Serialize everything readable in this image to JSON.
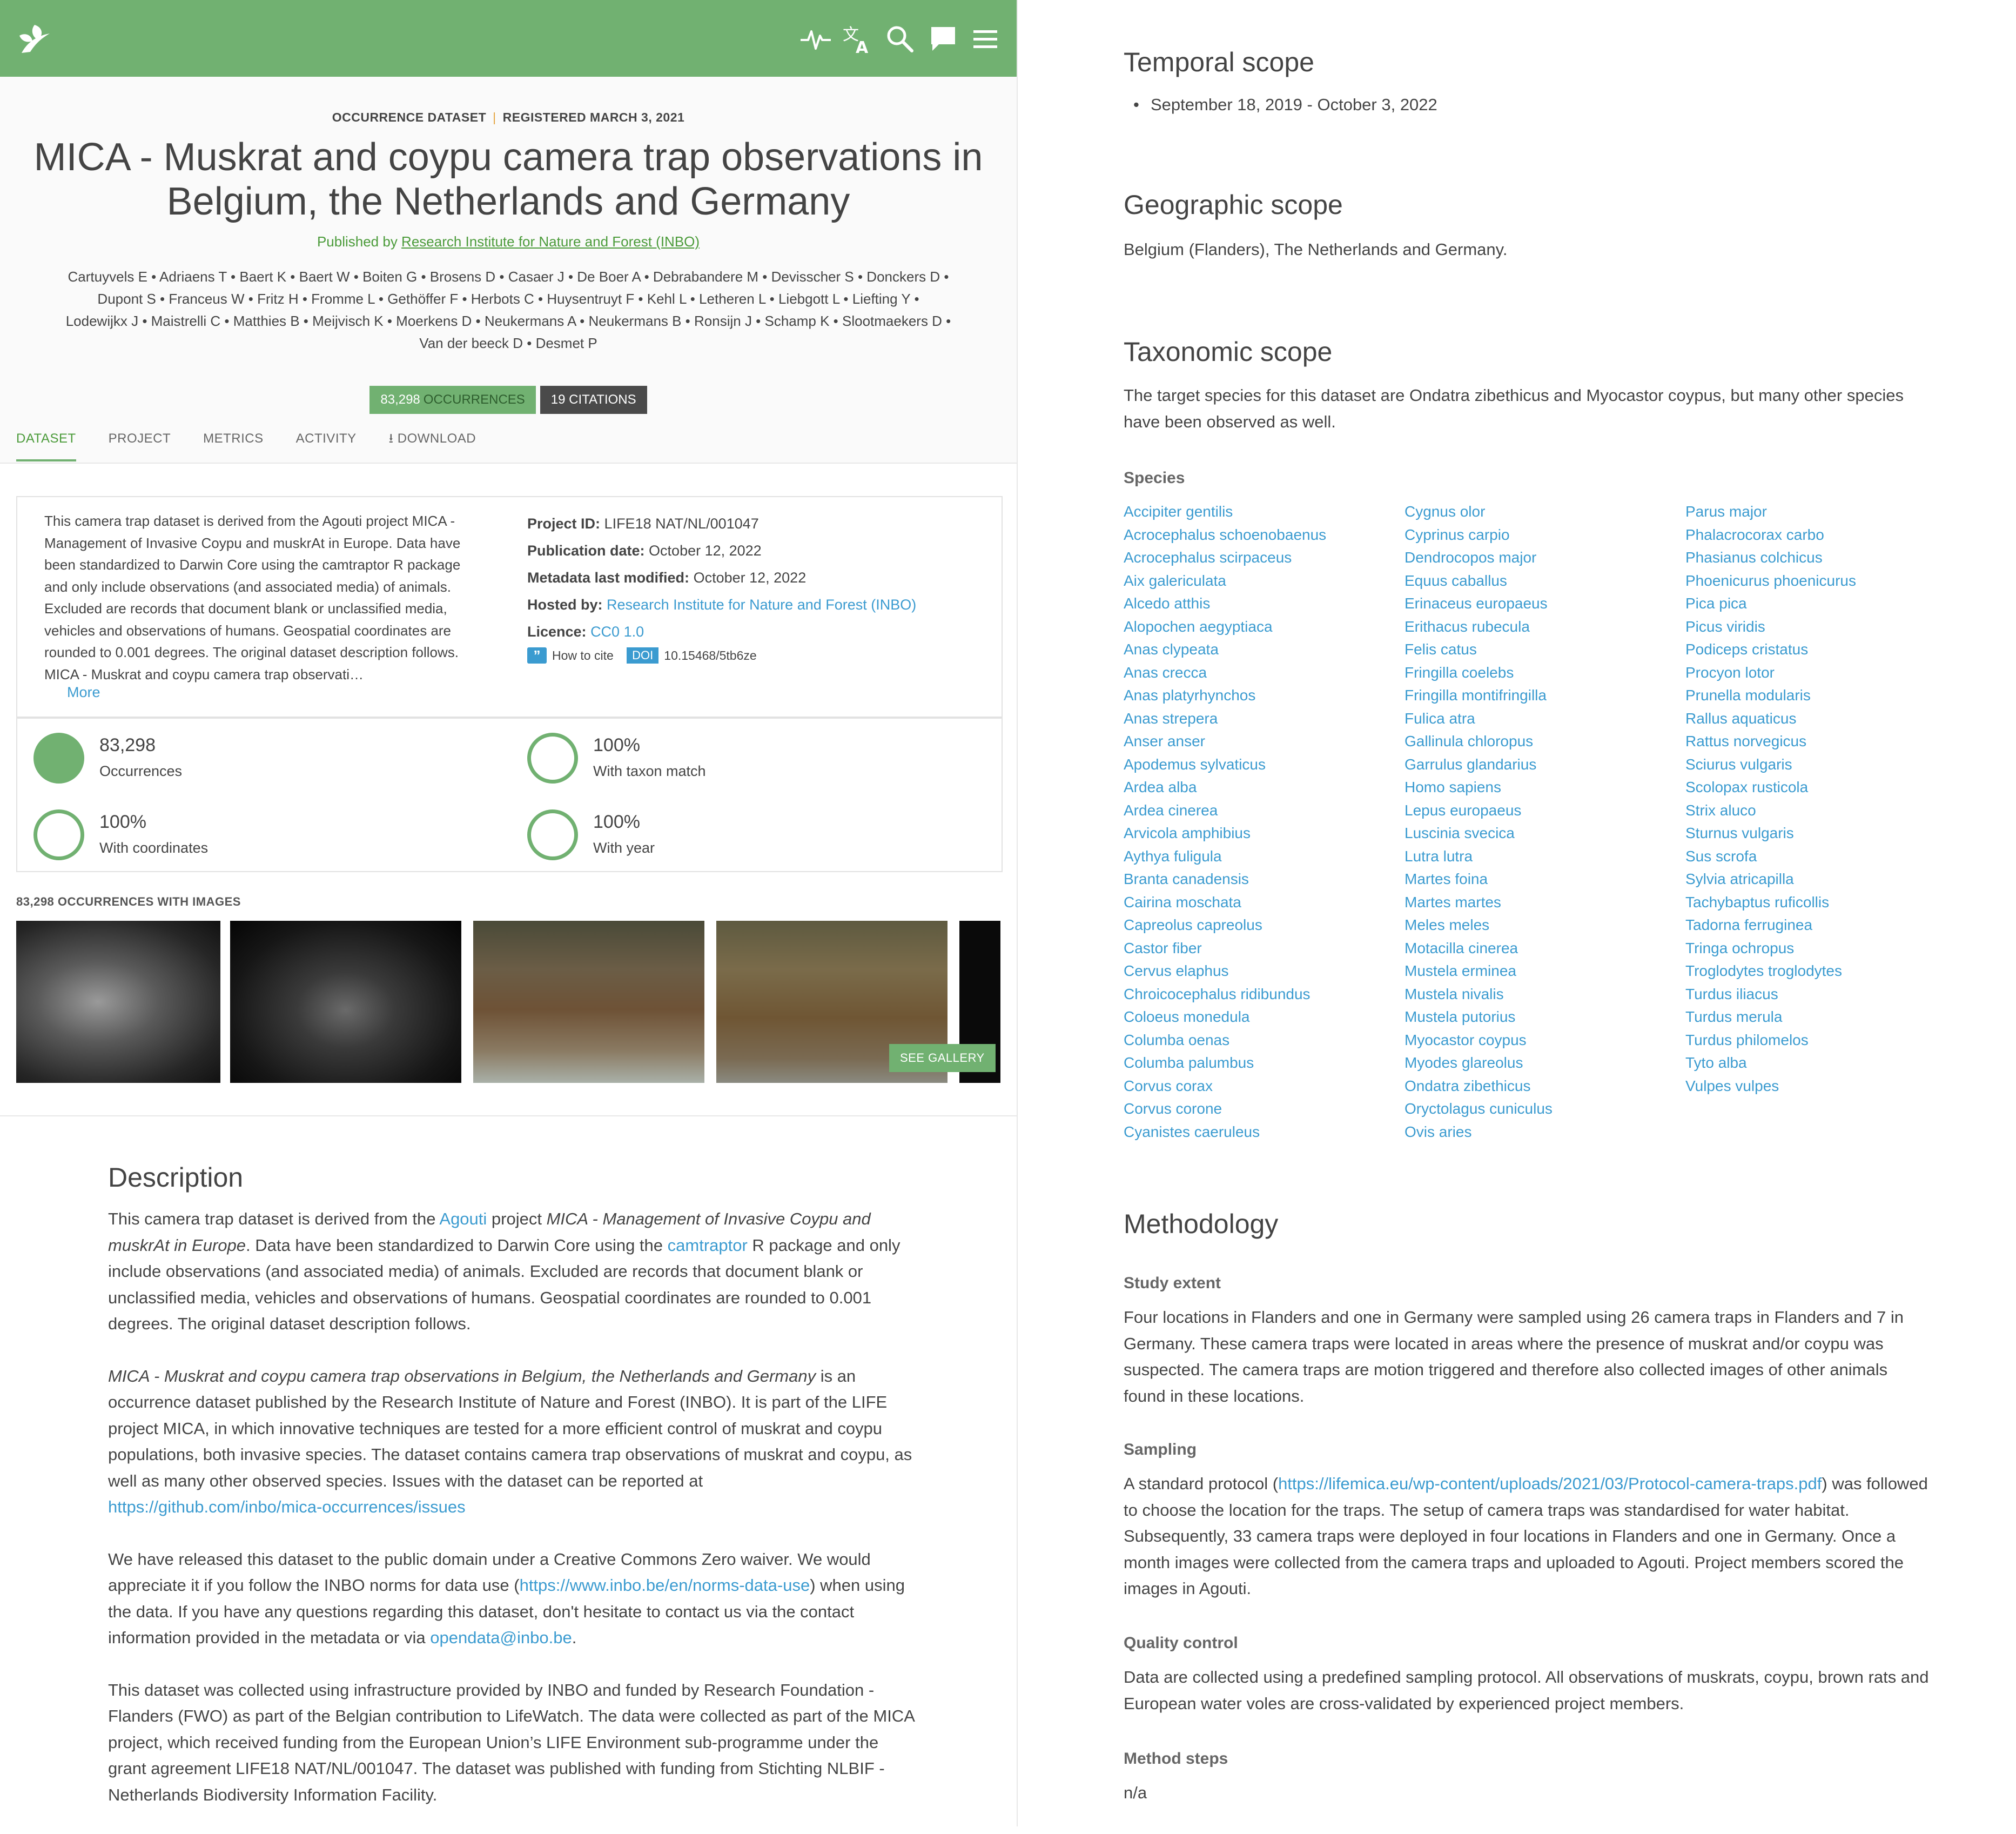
{
  "colors": {
    "brand_green": "#71b171",
    "link_blue": "#3b9bd0",
    "dark_badge": "#4a4a4a",
    "text": "#444444"
  },
  "topbar": {
    "logo_icon": "leaf-logo-icon",
    "icons": [
      "activity-icon",
      "translate-icon",
      "search-icon",
      "feedback-icon",
      "menu-icon"
    ]
  },
  "dataset": {
    "type": "OCCURRENCE DATASET",
    "separator": "|",
    "registered": "REGISTERED MARCH 3, 2021",
    "title": "MICA - Muskrat and coypu camera trap observations in Belgium, the Netherlands and Germany",
    "published_prefix": "Published by ",
    "publisher": "Research Institute for Nature and Forest (INBO)",
    "authors": [
      "Cartuyvels E • Adriaens T • Baert K • Baert W • Boiten G • Brosens D • Casaer J • De Boer A • Debrabandere M • Devisscher S • Donckers D •",
      "Dupont S • Franceus W • Fritz H • Fromme L • Gethöffer F • Herbots C • Huysentruyt F • Kehl L • Letheren L • Liebgott L • Liefting Y •",
      "Lodewijkx J • Maistrelli C • Matthies B • Meijvisch K • Moerkens D • Neukermans A • Neukermans B • Ronsijn J • Schamp K • Slootmaekers D •",
      "Van der beeck D • Desmet P"
    ],
    "occurrences_count": "83,298",
    "occurrences_label": "OCCURRENCES",
    "citations": "19 CITATIONS"
  },
  "tabs": [
    "DATASET",
    "PROJECT",
    "METRICS",
    "ACTIVITY",
    "DOWNLOAD"
  ],
  "summary": {
    "text": "This camera trap dataset is derived from the Agouti project MICA - Management of Invasive Coypu and muskrAt in Europe. Data have been standardized to Darwin Core using the camtraptor R package and only include observations (and associated media) of animals. Excluded are records that document blank or unclassified media, vehicles and observations of humans. Geospatial coordinates are rounded to 0.001 degrees. The original dataset description follows. MICA - Muskrat and coypu camera trap observati…",
    "more": "More",
    "project_id_label": "Project ID:",
    "project_id": "LIFE18 NAT/NL/001047",
    "pub_date_label": "Publication date:",
    "pub_date": "October 12, 2022",
    "modified_label": "Metadata last modified:",
    "modified": "October 12, 2022",
    "hosted_label": "Hosted by:",
    "hosted": "Research Institute for Nature and Forest (INBO)",
    "licence_label": "Licence:",
    "licence": "CC0 1.0",
    "cite_icon": "”",
    "how_to_cite": "How to cite",
    "doi_label": "DOI",
    "doi": "10.15468/5tb6ze"
  },
  "metrics": [
    {
      "value": "83,298",
      "label": "Occurrences",
      "fill": 1.0
    },
    {
      "value": "100%",
      "label": "With taxon match",
      "fill": 1.0
    },
    {
      "value": "100%",
      "label": "With coordinates",
      "fill": 1.0
    },
    {
      "value": "100%",
      "label": "With year",
      "fill": 1.0
    }
  ],
  "images": {
    "heading": "83,298 OCCURRENCES WITH IMAGES",
    "see_gallery": "SEE GALLERY"
  },
  "description": {
    "heading": "Description",
    "p1_a": "This camera trap dataset is derived from the ",
    "p1_link1": "Agouti",
    "p1_b": " project ",
    "p1_em": "MICA - Management of Invasive Coypu and muskrAt in Europe",
    "p1_c": ". Data have been standardized to Darwin Core using the ",
    "p1_link2": "camtraptor",
    "p1_d": " R package and only include observations (and associated media) of animals. Excluded are records that document blank or unclassified media, vehicles and observations of humans. Geospatial coordinates are rounded to 0.001 degrees. The original dataset description follows.",
    "p2_em": "MICA - Muskrat and coypu camera trap observations in Belgium, the Netherlands and Germany",
    "p2_a": " is an occurrence dataset published by the Research Institute of Nature and Forest (INBO). It is part of the LIFE project MICA, in which innovative techniques are tested for a more efficient control of muskrat and coypu populations, both invasive species. The dataset contains camera trap observations of muskrat and coypu, as well as many other observed species. Issues with the dataset can be reported at ",
    "p2_link": "https://github.com/inbo/mica-occurrences/issues",
    "p3_a": "We have released this dataset to the public domain under a Creative Commons Zero waiver. We would appreciate it if you follow the INBO norms for data use (",
    "p3_link1": "https://www.inbo.be/en/norms-data-use",
    "p3_b": ") when using the data. If you have any questions regarding this dataset, don't hesitate to contact us via the contact information provided in the metadata or via ",
    "p3_link2": "opendata@inbo.be",
    "p3_c": ".",
    "p4": "This dataset was collected using infrastructure provided by INBO and funded by Research Foundation - Flanders (FWO) as part of the Belgian contribution to LifeWatch. The data were collected as part of the MICA project, which received funding from the European Union’s LIFE Environment sub-programme under the grant agreement LIFE18 NAT/NL/001047. The dataset was published with funding from Stichting NLBIF - Netherlands Biodiversity Information Facility."
  },
  "temporal": {
    "heading": "Temporal scope",
    "range": "September 18, 2019 - October 3, 2022"
  },
  "geographic": {
    "heading": "Geographic scope",
    "text": "Belgium (Flanders), The Netherlands and Germany."
  },
  "taxonomic": {
    "heading": "Taxonomic scope",
    "text": "The target species for this dataset are Ondatra zibethicus and Myocastor coypus, but many other species have been observed as well.",
    "species_heading": "Species",
    "species_cols": [
      [
        "Accipiter gentilis",
        "Acrocephalus schoenobaenus",
        "Acrocephalus scirpaceus",
        "Aix galericulata",
        "Alcedo atthis",
        "Alopochen aegyptiaca",
        "Anas clypeata",
        "Anas crecca",
        "Anas platyrhynchos",
        "Anas strepera",
        "Anser anser",
        "Apodemus sylvaticus",
        "Ardea alba",
        "Ardea cinerea",
        "Arvicola amphibius",
        "Aythya fuligula",
        "Branta canadensis",
        "Cairina moschata",
        "Capreolus capreolus",
        "Castor fiber",
        "Cervus elaphus",
        "Chroicocephalus ridibundus",
        "Coloeus monedula",
        "Columba oenas",
        "Columba palumbus",
        "Corvus corax",
        "Corvus corone",
        "Cyanistes caeruleus"
      ],
      [
        "Cygnus olor",
        "Cyprinus carpio",
        "Dendrocopos major",
        "Equus caballus",
        "Erinaceus europaeus",
        "Erithacus rubecula",
        "Felis catus",
        "Fringilla coelebs",
        "Fringilla montifringilla",
        "Fulica atra",
        "Gallinula chloropus",
        "Garrulus glandarius",
        "Homo sapiens",
        "Lepus europaeus",
        "Luscinia svecica",
        "Lutra lutra",
        "Martes foina",
        "Martes martes",
        "Meles meles",
        "Motacilla cinerea",
        "Mustela erminea",
        "Mustela nivalis",
        "Mustela putorius",
        "Myocastor coypus",
        "Myodes glareolus",
        "Ondatra zibethicus",
        "Oryctolagus cuniculus",
        "Ovis aries"
      ],
      [
        "Parus major",
        "Phalacrocorax carbo",
        "Phasianus colchicus",
        "Phoenicurus phoenicurus",
        "Pica pica",
        "Picus viridis",
        "Podiceps cristatus",
        "Procyon lotor",
        "Prunella modularis",
        "Rallus aquaticus",
        "Rattus norvegicus",
        "Sciurus vulgaris",
        "Scolopax rusticola",
        "Strix aluco",
        "Sturnus vulgaris",
        "Sus scrofa",
        "Sylvia atricapilla",
        "Tachybaptus ruficollis",
        "Tadorna ferruginea",
        "Tringa ochropus",
        "Troglodytes troglodytes",
        "Turdus iliacus",
        "Turdus merula",
        "Turdus philomelos",
        "Tyto alba",
        "Vulpes vulpes"
      ]
    ]
  },
  "methodology": {
    "heading": "Methodology",
    "study_extent_h": "Study extent",
    "study_extent": "Four locations in Flanders and one in Germany were sampled using 26 camera traps in Flanders and 7 in Germany. These camera traps were located in areas where the presence of muskrat and/or coypu was suspected. The camera traps are motion triggered and therefore also collected images of other animals found in these locations.",
    "sampling_h": "Sampling",
    "sampling_a": "A standard protocol (",
    "sampling_link": "https://lifemica.eu/wp-content/uploads/2021/03/Protocol-camera-traps.pdf",
    "sampling_b": ") was followed to choose the location for the traps. The setup of camera traps was standardised for water habitat. Subsequently, 33 camera traps were deployed in four locations in Flanders and one in Germany. Once a month images were collected from the camera traps and uploaded to Agouti. Project members scored the images in Agouti.",
    "quality_h": "Quality control",
    "quality": "Data are collected using a predefined sampling protocol. All observations of muskrats, coypu, brown rats and European water voles are cross-validated by experienced project members.",
    "steps_h": "Method steps",
    "steps": "n/a"
  }
}
